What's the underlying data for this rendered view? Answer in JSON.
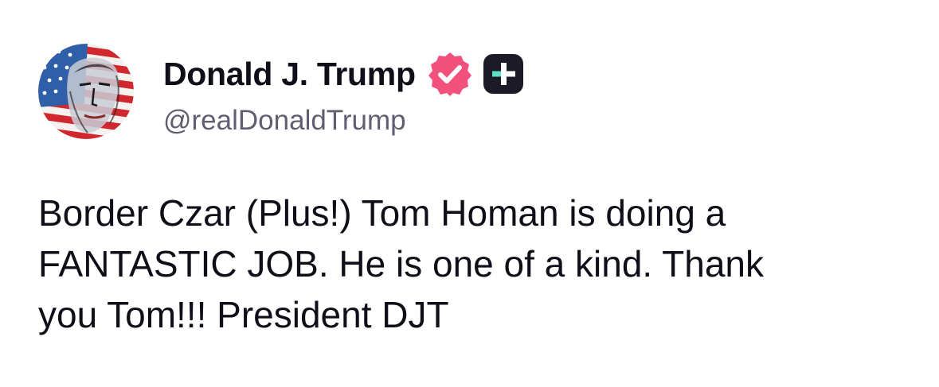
{
  "post": {
    "author": {
      "display_name": "Donald J. Trump",
      "handle": "@realDonaldTrump",
      "avatar_icon": "flag-portrait-avatar",
      "verified_icon": "verified-badge-icon",
      "plus_icon": "truth-plus-icon"
    },
    "body_lines": [
      "Border Czar (Plus!) Tom Homan is doing a",
      "FANTASTIC JOB. He is one of a kind. Thank",
      "you Tom!!! President DJT"
    ]
  },
  "colors": {
    "text": "#0f0f1a",
    "handle": "#605e70",
    "verified": "#f1517c",
    "plus_badge_bg": "#1b1a26",
    "plus_badge_accent": "#5ee0c4"
  }
}
